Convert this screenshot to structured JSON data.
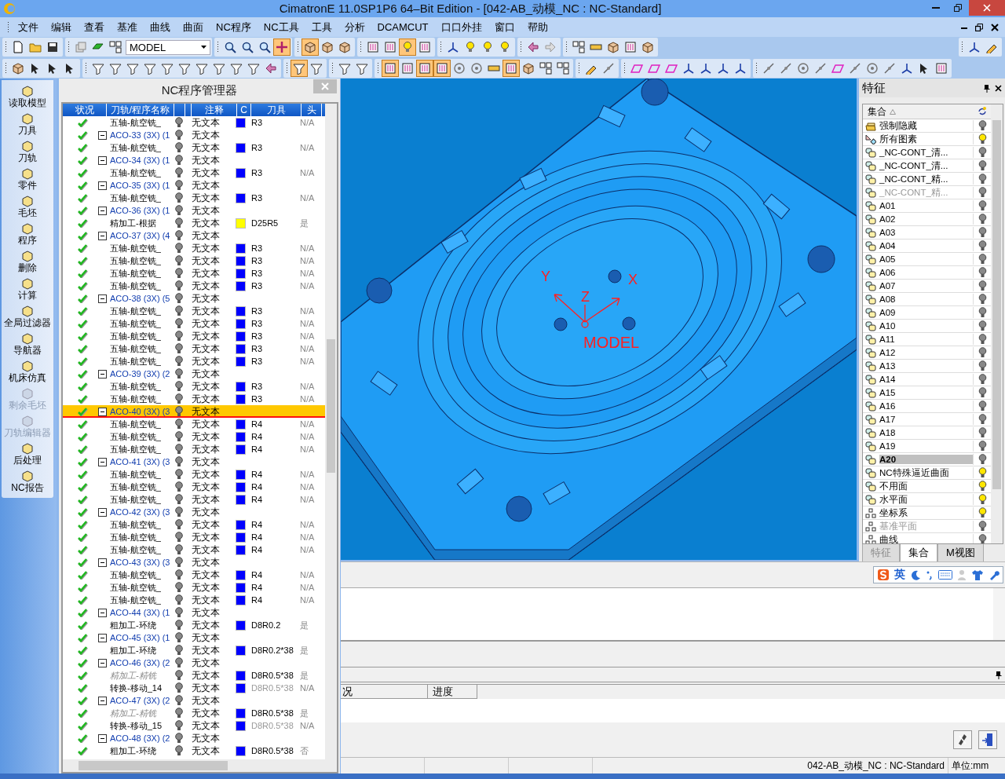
{
  "window": {
    "title": "CimatronE 11.0SP1P6 64–Bit Edition - [042-AB_动模_NC : NC-Standard]"
  },
  "menu": [
    "文件",
    "编辑",
    "查看",
    "基准",
    "曲线",
    "曲面",
    "NC程序",
    "NC工具",
    "工具",
    "分析",
    "DCAMCUT",
    "口口外挂",
    "窗口",
    "帮助"
  ],
  "toolbar_1": {
    "groups": [
      [
        {
          "kind": "new",
          "pressed": false
        },
        {
          "kind": "open",
          "pressed": false
        },
        {
          "kind": "save",
          "pressed": false
        }
      ],
      [
        {
          "kind": "layers",
          "pressed": false
        },
        {
          "kind": "shape",
          "pressed": false
        },
        {
          "kind": "grid",
          "pressed": false
        }
      ],
      [
        {
          "kind": "zoom",
          "pressed": false
        },
        {
          "kind": "zoom",
          "pressed": false
        },
        {
          "kind": "zoom",
          "pressed": false
        },
        {
          "kind": "pan",
          "pressed": true
        }
      ],
      [
        {
          "kind": "cube",
          "pressed": true
        },
        {
          "kind": "cube",
          "pressed": false
        },
        {
          "kind": "cube",
          "pressed": false
        }
      ],
      [
        {
          "kind": "frame",
          "pressed": false
        },
        {
          "kind": "frame",
          "pressed": false
        },
        {
          "kind": "bulb",
          "pressed": true
        },
        {
          "kind": "frame",
          "pressed": false
        }
      ],
      [
        {
          "kind": "axis",
          "pressed": false
        },
        {
          "kind": "bulb",
          "pressed": false
        },
        {
          "kind": "bulb",
          "pressed": false
        },
        {
          "kind": "bulb",
          "pressed": false
        }
      ],
      [
        {
          "kind": "arrow-left",
          "pressed": false
        },
        {
          "kind": "arrow-right",
          "pressed": false
        }
      ],
      [
        {
          "kind": "grid",
          "pressed": false
        },
        {
          "kind": "ruler",
          "pressed": false
        },
        {
          "kind": "cube",
          "pressed": false
        },
        {
          "kind": "frame",
          "pressed": false
        },
        {
          "kind": "cube",
          "pressed": false
        }
      ]
    ],
    "right": [
      {
        "kind": "axis",
        "pressed": false
      },
      {
        "kind": "pencil",
        "pressed": false
      }
    ],
    "combo": {
      "value": "MODEL"
    }
  },
  "toolbar_2": {
    "groups": [
      [
        {
          "kind": "cube",
          "pressed": false
        },
        {
          "kind": "cursor",
          "pressed": false
        },
        {
          "kind": "cursor",
          "pressed": false
        },
        {
          "kind": "cursor",
          "pressed": false
        }
      ],
      [
        {
          "kind": "funnel",
          "pressed": false
        },
        {
          "kind": "funnel",
          "pressed": false
        },
        {
          "kind": "funnel",
          "pressed": false
        },
        {
          "kind": "funnel",
          "pressed": false
        },
        {
          "kind": "funnel",
          "pressed": false
        },
        {
          "kind": "funnel",
          "pressed": false
        },
        {
          "kind": "funnel",
          "pressed": false
        },
        {
          "kind": "funnel",
          "pressed": false
        },
        {
          "kind": "funnel",
          "pressed": false
        },
        {
          "kind": "funnel",
          "pressed": false
        },
        {
          "kind": "arrow-left",
          "pressed": false
        }
      ],
      [
        {
          "kind": "funnel",
          "pressed": true
        },
        {
          "kind": "funnel",
          "pressed": false
        }
      ],
      [
        {
          "kind": "funnel",
          "pressed": false
        },
        {
          "kind": "funnel",
          "pressed": false
        }
      ],
      [
        {
          "kind": "frame",
          "pressed": true
        },
        {
          "kind": "frame",
          "pressed": false
        },
        {
          "kind": "frame",
          "pressed": true
        },
        {
          "kind": "frame",
          "pressed": true
        },
        {
          "kind": "circle",
          "pressed": false
        },
        {
          "kind": "circle",
          "pressed": false
        },
        {
          "kind": "ruler",
          "pressed": false
        },
        {
          "kind": "frame",
          "pressed": true
        },
        {
          "kind": "cube",
          "pressed": false
        },
        {
          "kind": "grid",
          "pressed": false
        },
        {
          "kind": "grid",
          "pressed": false
        }
      ],
      [
        {
          "kind": "pencil",
          "pressed": false
        },
        {
          "kind": "line",
          "pressed": false
        }
      ],
      [
        {
          "kind": "plane",
          "pressed": false
        },
        {
          "kind": "plane",
          "pressed": false
        },
        {
          "kind": "plane",
          "pressed": false
        },
        {
          "kind": "axis",
          "pressed": false
        },
        {
          "kind": "axis",
          "pressed": false
        },
        {
          "kind": "axis",
          "pressed": false
        },
        {
          "kind": "axis",
          "pressed": false
        }
      ],
      [
        {
          "kind": "line",
          "pressed": false
        },
        {
          "kind": "line",
          "pressed": false
        },
        {
          "kind": "circle",
          "pressed": false
        },
        {
          "kind": "line",
          "pressed": false
        },
        {
          "kind": "plane",
          "pressed": false
        },
        {
          "kind": "line",
          "pressed": false
        },
        {
          "kind": "circle",
          "pressed": false
        },
        {
          "kind": "line",
          "pressed": false
        },
        {
          "kind": "axis",
          "pressed": false
        },
        {
          "kind": "cursor",
          "pressed": false
        },
        {
          "kind": "frame",
          "pressed": false
        }
      ]
    ]
  },
  "sidebar": [
    {
      "label": "读取模型",
      "disabled": false
    },
    {
      "label": "刀具",
      "disabled": false
    },
    {
      "label": "刀轨",
      "disabled": false
    },
    {
      "label": "零件",
      "disabled": false
    },
    {
      "label": "毛坯",
      "disabled": false
    },
    {
      "label": "程序",
      "disabled": false
    },
    {
      "label": "删除",
      "disabled": false
    },
    {
      "label": "计算",
      "disabled": false
    },
    {
      "label": "全局过滤器",
      "disabled": false
    },
    {
      "label": "导航器",
      "disabled": false
    },
    {
      "label": "机床仿真",
      "disabled": false
    },
    {
      "label": "剩余毛坯",
      "disabled": true
    },
    {
      "label": "刀轨编辑器",
      "disabled": true
    },
    {
      "label": "后处理",
      "disabled": false
    },
    {
      "label": "NC报告",
      "disabled": false
    }
  ],
  "nc_manager": {
    "title": "NC程序管理器",
    "columns": [
      "状况",
      "刀轨/程序名称",
      "",
      "",
      "注释",
      "C",
      "刀具",
      "头"
    ],
    "items": [
      {
        "kind": "operation",
        "name": "五轴-航空铣_",
        "comment": "无文本",
        "color": "#0000ff",
        "tool": "R3",
        "flag": "N/A",
        "selected": false
      },
      {
        "kind": "group",
        "name": "ACO-33 (3X) (1",
        "comment": "无文本",
        "expanded": true,
        "selected": false,
        "children": [
          {
            "kind": "operation",
            "name": "五轴-航空铣_",
            "comment": "无文本",
            "color": "#0000ff",
            "tool": "R3",
            "flag": "N/A",
            "selected": false
          }
        ]
      },
      {
        "kind": "group",
        "name": "ACO-34 (3X) (1",
        "comment": "无文本",
        "expanded": true,
        "selected": false,
        "children": [
          {
            "kind": "operation",
            "name": "五轴-航空铣_",
            "comment": "无文本",
            "color": "#0000ff",
            "tool": "R3",
            "flag": "N/A",
            "selected": false
          }
        ]
      },
      {
        "kind": "group",
        "name": "ACO-35 (3X) (1",
        "comment": "无文本",
        "expanded": true,
        "selected": false,
        "children": [
          {
            "kind": "operation",
            "name": "五轴-航空铣_",
            "comment": "无文本",
            "color": "#0000ff",
            "tool": "R3",
            "flag": "N/A",
            "selected": false
          }
        ]
      },
      {
        "kind": "group",
        "name": "ACO-36 (3X) (1",
        "comment": "无文本",
        "expanded": true,
        "selected": false,
        "children": [
          {
            "kind": "operation",
            "name": "精加工-根据",
            "comment": "无文本",
            "color": "#ffff00",
            "tool": "D25R5",
            "flag": "是",
            "selected": false
          }
        ]
      },
      {
        "kind": "group",
        "name": "ACO-37 (3X) (4",
        "comment": "无文本",
        "expanded": true,
        "selected": false,
        "children": [
          {
            "kind": "operation",
            "name": "五轴-航空铣_",
            "comment": "无文本",
            "color": "#0000ff",
            "tool": "R3",
            "flag": "N/A",
            "selected": false
          },
          {
            "kind": "operation",
            "name": "五轴-航空铣_",
            "comment": "无文本",
            "color": "#0000ff",
            "tool": "R3",
            "flag": "N/A",
            "selected": false
          },
          {
            "kind": "operation",
            "name": "五轴-航空铣_",
            "comment": "无文本",
            "color": "#0000ff",
            "tool": "R3",
            "flag": "N/A",
            "selected": false
          },
          {
            "kind": "operation",
            "name": "五轴-航空铣_",
            "comment": "无文本",
            "color": "#0000ff",
            "tool": "R3",
            "flag": "N/A",
            "selected": false
          }
        ]
      },
      {
        "kind": "group",
        "name": "ACO-38 (3X) (5",
        "comment": "无文本",
        "expanded": true,
        "selected": false,
        "children": [
          {
            "kind": "operation",
            "name": "五轴-航空铣_",
            "comment": "无文本",
            "color": "#0000ff",
            "tool": "R3",
            "flag": "N/A",
            "selected": false
          },
          {
            "kind": "operation",
            "name": "五轴-航空铣_",
            "comment": "无文本",
            "color": "#0000ff",
            "tool": "R3",
            "flag": "N/A",
            "selected": false
          },
          {
            "kind": "operation",
            "name": "五轴-航空铣_",
            "comment": "无文本",
            "color": "#0000ff",
            "tool": "R3",
            "flag": "N/A",
            "selected": false
          },
          {
            "kind": "operation",
            "name": "五轴-航空铣_",
            "comment": "无文本",
            "color": "#0000ff",
            "tool": "R3",
            "flag": "N/A",
            "selected": false
          },
          {
            "kind": "operation",
            "name": "五轴-航空铣_",
            "comment": "无文本",
            "color": "#0000ff",
            "tool": "R3",
            "flag": "N/A",
            "selected": false
          }
        ]
      },
      {
        "kind": "group",
        "name": "ACO-39 (3X) (2",
        "comment": "无文本",
        "expanded": true,
        "selected": false,
        "children": [
          {
            "kind": "operation",
            "name": "五轴-航空铣_",
            "comment": "无文本",
            "color": "#0000ff",
            "tool": "R3",
            "flag": "N/A",
            "selected": false
          },
          {
            "kind": "operation",
            "name": "五轴-航空铣_",
            "comment": "无文本",
            "color": "#0000ff",
            "tool": "R3",
            "flag": "N/A",
            "selected": false
          }
        ]
      },
      {
        "kind": "group",
        "name": "ACO-40 (3X) (3",
        "comment": "无文本",
        "expanded": true,
        "selected": true,
        "children": [
          {
            "kind": "operation",
            "name": "五轴-航空铣_",
            "comment": "无文本",
            "color": "#0000ff",
            "tool": "R4",
            "flag": "N/A",
            "selected": false
          },
          {
            "kind": "operation",
            "name": "五轴-航空铣_",
            "comment": "无文本",
            "color": "#0000ff",
            "tool": "R4",
            "flag": "N/A",
            "selected": false
          },
          {
            "kind": "operation",
            "name": "五轴-航空铣_",
            "comment": "无文本",
            "color": "#0000ff",
            "tool": "R4",
            "flag": "N/A",
            "selected": false
          }
        ]
      },
      {
        "kind": "group",
        "name": "ACO-41 (3X) (3",
        "comment": "无文本",
        "expanded": true,
        "selected": false,
        "children": [
          {
            "kind": "operation",
            "name": "五轴-航空铣_",
            "comment": "无文本",
            "color": "#0000ff",
            "tool": "R4",
            "flag": "N/A",
            "selected": false
          },
          {
            "kind": "operation",
            "name": "五轴-航空铣_",
            "comment": "无文本",
            "color": "#0000ff",
            "tool": "R4",
            "flag": "N/A",
            "selected": false
          },
          {
            "kind": "operation",
            "name": "五轴-航空铣_",
            "comment": "无文本",
            "color": "#0000ff",
            "tool": "R4",
            "flag": "N/A",
            "selected": false
          }
        ]
      },
      {
        "kind": "group",
        "name": "ACO-42 (3X) (3",
        "comment": "无文本",
        "expanded": true,
        "selected": false,
        "children": [
          {
            "kind": "operation",
            "name": "五轴-航空铣_",
            "comment": "无文本",
            "color": "#0000ff",
            "tool": "R4",
            "flag": "N/A",
            "selected": false
          },
          {
            "kind": "operation",
            "name": "五轴-航空铣_",
            "comment": "无文本",
            "color": "#0000ff",
            "tool": "R4",
            "flag": "N/A",
            "selected": false
          },
          {
            "kind": "operation",
            "name": "五轴-航空铣_",
            "comment": "无文本",
            "color": "#0000ff",
            "tool": "R4",
            "flag": "N/A",
            "selected": false
          }
        ]
      },
      {
        "kind": "group",
        "name": "ACO-43 (3X) (3",
        "comment": "无文本",
        "expanded": true,
        "selected": false,
        "children": [
          {
            "kind": "operation",
            "name": "五轴-航空铣_",
            "comment": "无文本",
            "color": "#0000ff",
            "tool": "R4",
            "flag": "N/A",
            "selected": false
          },
          {
            "kind": "operation",
            "name": "五轴-航空铣_",
            "comment": "无文本",
            "color": "#0000ff",
            "tool": "R4",
            "flag": "N/A",
            "selected": false
          },
          {
            "kind": "operation",
            "name": "五轴-航空铣_",
            "comment": "无文本",
            "color": "#0000ff",
            "tool": "R4",
            "flag": "N/A",
            "selected": false
          }
        ]
      },
      {
        "kind": "group",
        "name": "ACO-44 (3X) (1",
        "comment": "无文本",
        "expanded": true,
        "selected": false,
        "children": [
          {
            "kind": "operation",
            "name": "粗加工-环绕",
            "comment": "无文本",
            "color": "#0000ff",
            "tool": "D8R0.2",
            "flag": "是",
            "selected": false
          }
        ]
      },
      {
        "kind": "group",
        "name": "ACO-45 (3X) (1",
        "comment": "无文本",
        "expanded": true,
        "selected": false,
        "children": [
          {
            "kind": "operation",
            "name": "粗加工-环绕",
            "comment": "无文本",
            "color": "#0000ff",
            "tool": "D8R0.2*38",
            "flag": "是",
            "selected": false
          }
        ]
      },
      {
        "kind": "group",
        "name": "ACO-46 (3X) (2",
        "comment": "无文本",
        "expanded": true,
        "selected": false,
        "children": [
          {
            "kind": "suppressed",
            "name": "精加工-精铣",
            "comment": "无文本",
            "color": "#0000ff",
            "tool": "D8R0.5*38",
            "flag": "是",
            "selected": false
          },
          {
            "kind": "transform",
            "name": "转换-移动_14",
            "comment": "无文本",
            "color": "#0000ff",
            "tool": "D8R0.5*38",
            "flag": "N/A",
            "selected": false
          }
        ]
      },
      {
        "kind": "group",
        "name": "ACO-47 (3X) (2",
        "comment": "无文本",
        "expanded": true,
        "selected": false,
        "children": [
          {
            "kind": "suppressed",
            "name": "精加工-精铣",
            "comment": "无文本",
            "color": "#0000ff",
            "tool": "D8R0.5*38",
            "flag": "是",
            "selected": false
          },
          {
            "kind": "transform",
            "name": "转换-移动_15",
            "comment": "无文本",
            "color": "#0000ff",
            "tool": "D8R0.5*38",
            "flag": "N/A",
            "selected": false
          }
        ]
      },
      {
        "kind": "group",
        "name": "ACO-48 (3X) (2",
        "comment": "无文本",
        "expanded": true,
        "selected": false,
        "children": [
          {
            "kind": "operation",
            "name": "粗加工-环绕",
            "comment": "无文本",
            "color": "#0000ff",
            "tool": "D8R0.5*38",
            "flag": "否",
            "selected": false
          }
        ]
      }
    ]
  },
  "viewport": {
    "labels": [
      {
        "kind": "axis",
        "text": "Y"
      },
      {
        "kind": "axis",
        "text": "X"
      },
      {
        "kind": "axis",
        "text": "Z"
      },
      {
        "kind": "name",
        "text": "MODEL"
      }
    ]
  },
  "features": {
    "title": "特征",
    "column": "集合",
    "items": [
      {
        "kind": "stack",
        "name": "强制隐藏",
        "lit": false,
        "dimmed": false,
        "selected": false
      },
      {
        "kind": "elements",
        "name": "所有图素",
        "lit": true,
        "dimmed": false,
        "selected": false
      },
      {
        "kind": "set",
        "name": "_NC-CONT_清...",
        "lit": false,
        "dimmed": false,
        "selected": false
      },
      {
        "kind": "set",
        "name": "_NC-CONT_清...",
        "lit": false,
        "dimmed": false,
        "selected": false
      },
      {
        "kind": "set",
        "name": "_NC-CONT_精...",
        "lit": false,
        "dimmed": false,
        "selected": false
      },
      {
        "kind": "set",
        "name": "_NC-CONT_精...",
        "lit": false,
        "dimmed": true,
        "selected": false
      },
      {
        "kind": "set",
        "name": "A01",
        "lit": false,
        "dimmed": false,
        "selected": false
      },
      {
        "kind": "set",
        "name": "A02",
        "lit": false,
        "dimmed": false,
        "selected": false
      },
      {
        "kind": "set",
        "name": "A03",
        "lit": false,
        "dimmed": false,
        "selected": false
      },
      {
        "kind": "set",
        "name": "A04",
        "lit": false,
        "dimmed": false,
        "selected": false
      },
      {
        "kind": "set",
        "name": "A05",
        "lit": false,
        "dimmed": false,
        "selected": false
      },
      {
        "kind": "set",
        "name": "A06",
        "lit": false,
        "dimmed": false,
        "selected": false
      },
      {
        "kind": "set",
        "name": "A07",
        "lit": false,
        "dimmed": false,
        "selected": false
      },
      {
        "kind": "set",
        "name": "A08",
        "lit": false,
        "dimmed": false,
        "selected": false
      },
      {
        "kind": "set",
        "name": "A09",
        "lit": false,
        "dimmed": false,
        "selected": false
      },
      {
        "kind": "set",
        "name": "A10",
        "lit": false,
        "dimmed": false,
        "selected": false
      },
      {
        "kind": "set",
        "name": "A11",
        "lit": false,
        "dimmed": false,
        "selected": false
      },
      {
        "kind": "set",
        "name": "A12",
        "lit": false,
        "dimmed": false,
        "selected": false
      },
      {
        "kind": "set",
        "name": "A13",
        "lit": false,
        "dimmed": false,
        "selected": false
      },
      {
        "kind": "set",
        "name": "A14",
        "lit": false,
        "dimmed": false,
        "selected": false
      },
      {
        "kind": "set",
        "name": "A15",
        "lit": false,
        "dimmed": false,
        "selected": false
      },
      {
        "kind": "set",
        "name": "A16",
        "lit": false,
        "dimmed": false,
        "selected": false
      },
      {
        "kind": "set",
        "name": "A17",
        "lit": false,
        "dimmed": false,
        "selected": false
      },
      {
        "kind": "set",
        "name": "A18",
        "lit": false,
        "dimmed": false,
        "selected": false
      },
      {
        "kind": "set",
        "name": "A19",
        "lit": false,
        "dimmed": false,
        "selected": false
      },
      {
        "kind": "set",
        "name": "A20",
        "lit": false,
        "dimmed": false,
        "selected": true
      },
      {
        "kind": "set",
        "name": "NC特殊逼近曲面",
        "lit": true,
        "dimmed": false,
        "selected": false
      },
      {
        "kind": "set",
        "name": "不用面",
        "lit": true,
        "dimmed": false,
        "selected": false
      },
      {
        "kind": "set",
        "name": "水平面",
        "lit": true,
        "dimmed": false,
        "selected": false
      },
      {
        "kind": "frame",
        "name": "坐标系",
        "lit": true,
        "dimmed": false,
        "selected": false
      },
      {
        "kind": "frame",
        "name": "基准平面",
        "lit": false,
        "dimmed": true,
        "selected": false
      },
      {
        "kind": "frame",
        "name": "曲线",
        "lit": false,
        "dimmed": false,
        "selected": false
      }
    ],
    "tabs": [
      {
        "label": "特征",
        "selected": false
      },
      {
        "label": "集合",
        "selected": true
      },
      {
        "label": "M视图",
        "selected": false
      }
    ]
  },
  "ime": {
    "mode": "英"
  },
  "progress": {
    "columns": [
      "况",
      "进度"
    ]
  },
  "status_bar": [
    "042-AB_动模_NC : NC-Standard",
    "单位:mm"
  ]
}
